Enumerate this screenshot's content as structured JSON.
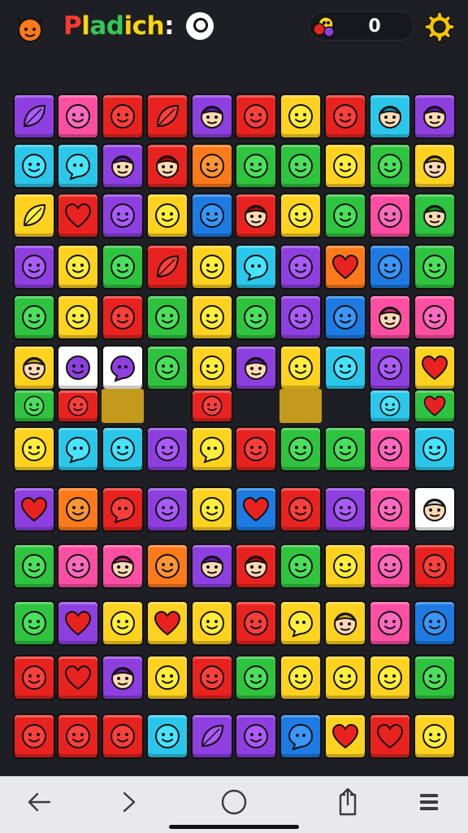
{
  "header": {
    "title_letters": [
      "P",
      "l",
      "a",
      "d",
      "i",
      "c",
      "h",
      ":"
    ],
    "title_colors": [
      "#ff3b30",
      "#ffd60a",
      "#34c759",
      "#34c759",
      "#ffcc00",
      "#ffd60a",
      "#ffd60a",
      "#ffffff"
    ],
    "score": "0",
    "icons": {
      "avatar": "fox-face-icon",
      "badge": "ring-icon",
      "score": "critter-icon",
      "settings": "gear-icon"
    }
  },
  "palette": {
    "V": "#8e3fe0",
    "P": "#ff4fa3",
    "R": "#e8231f",
    "Y": "#ffd21f",
    "G": "#2fc43f",
    "B": "#1d7be3",
    "C": "#2bc7ea",
    "O": "#ff7a1a",
    "W": "#ffffff",
    "K": "#c49a1c"
  },
  "board": {
    "rows": [
      {
        "cells": [
          {
            "c": "V",
            "f": "leaf"
          },
          {
            "c": "P",
            "f": "face"
          },
          {
            "c": "R",
            "f": "face"
          },
          {
            "c": "R",
            "f": "leaf"
          },
          {
            "c": "V",
            "f": "person"
          },
          {
            "c": "R",
            "f": "face"
          },
          {
            "c": "Y",
            "f": "face"
          },
          {
            "c": "R",
            "f": "face"
          },
          {
            "c": "C",
            "f": "person"
          },
          {
            "c": "V",
            "f": "person"
          }
        ]
      },
      {
        "cells": [
          {
            "c": "C",
            "f": "face"
          },
          {
            "c": "C",
            "f": "bubble"
          },
          {
            "c": "V",
            "f": "person"
          },
          {
            "c": "R",
            "f": "person"
          },
          {
            "c": "O",
            "f": "face"
          },
          {
            "c": "G",
            "f": "face"
          },
          {
            "c": "G",
            "f": "face"
          },
          {
            "c": "Y",
            "f": "face"
          },
          {
            "c": "G",
            "f": "face"
          },
          {
            "c": "Y",
            "f": "person"
          }
        ]
      },
      {
        "cells": [
          {
            "c": "Y",
            "f": "leaf"
          },
          {
            "c": "R",
            "f": "heart"
          },
          {
            "c": "V",
            "f": "face"
          },
          {
            "c": "Y",
            "f": "face"
          },
          {
            "c": "B",
            "f": "face"
          },
          {
            "c": "R",
            "f": "person"
          },
          {
            "c": "Y",
            "f": "face"
          },
          {
            "c": "G",
            "f": "face"
          },
          {
            "c": "P",
            "f": "face"
          },
          {
            "c": "G",
            "f": "person"
          }
        ]
      },
      {
        "cells": [
          {
            "c": "V",
            "f": "face"
          },
          {
            "c": "Y",
            "f": "face"
          },
          {
            "c": "G",
            "f": "face"
          },
          {
            "c": "R",
            "f": "leaf"
          },
          {
            "c": "Y",
            "f": "face"
          },
          {
            "c": "C",
            "f": "bubble"
          },
          {
            "c": "V",
            "f": "face"
          },
          {
            "c": "O",
            "f": "heart"
          },
          {
            "c": "B",
            "f": "face"
          },
          {
            "c": "G",
            "f": "face"
          }
        ]
      },
      {
        "cells": [
          {
            "c": "G",
            "f": "face"
          },
          {
            "c": "Y",
            "f": "face"
          },
          {
            "c": "R",
            "f": "face"
          },
          {
            "c": "G",
            "f": "face"
          },
          {
            "c": "Y",
            "f": "face"
          },
          {
            "c": "G",
            "f": "face"
          },
          {
            "c": "V",
            "f": "face"
          },
          {
            "c": "B",
            "f": "face"
          },
          {
            "c": "P",
            "f": "person"
          },
          {
            "c": "P",
            "f": "face"
          }
        ]
      },
      {
        "cells": [
          {
            "c": "Y",
            "f": "person"
          },
          {
            "c": "W",
            "f": "face"
          },
          {
            "c": "W",
            "f": "bubble"
          },
          {
            "c": "G",
            "f": "face"
          },
          {
            "c": "Y",
            "f": "face"
          },
          {
            "c": "V",
            "f": "person"
          },
          {
            "c": "Y",
            "f": "face"
          },
          {
            "c": "C",
            "f": "face"
          },
          {
            "c": "V",
            "f": "face"
          },
          {
            "c": "Y",
            "f": "heart"
          }
        ]
      },
      {
        "cells": [
          {
            "c": "G",
            "f": "face"
          },
          {
            "c": "R",
            "f": "face"
          },
          {
            "c": "K",
            "f": "none"
          },
          {
            "c": "X",
            "f": "none"
          },
          {
            "c": "R",
            "f": "face"
          },
          {
            "c": "X",
            "f": "none"
          },
          {
            "c": "K",
            "f": "none"
          },
          {
            "c": "X",
            "f": "none"
          },
          {
            "c": "C",
            "f": "face"
          },
          {
            "c": "G",
            "f": "heart"
          }
        ]
      },
      {
        "cells": [
          {
            "c": "Y",
            "f": "face"
          },
          {
            "c": "C",
            "f": "bubble"
          },
          {
            "c": "C",
            "f": "face"
          },
          {
            "c": "V",
            "f": "face"
          },
          {
            "c": "Y",
            "f": "bubble"
          },
          {
            "c": "R",
            "f": "face"
          },
          {
            "c": "G",
            "f": "face"
          },
          {
            "c": "G",
            "f": "face"
          },
          {
            "c": "P",
            "f": "face"
          },
          {
            "c": "C",
            "f": "face"
          }
        ]
      },
      {
        "cells": [
          {
            "c": "V",
            "f": "heart"
          },
          {
            "c": "O",
            "f": "face"
          },
          {
            "c": "R",
            "f": "bubble"
          },
          {
            "c": "V",
            "f": "face"
          },
          {
            "c": "Y",
            "f": "face"
          },
          {
            "c": "B",
            "f": "heart"
          },
          {
            "c": "R",
            "f": "face"
          },
          {
            "c": "V",
            "f": "face"
          },
          {
            "c": "P",
            "f": "face"
          },
          {
            "c": "W",
            "f": "person"
          }
        ]
      },
      {
        "cells": [
          {
            "c": "G",
            "f": "face"
          },
          {
            "c": "P",
            "f": "face"
          },
          {
            "c": "P",
            "f": "person"
          },
          {
            "c": "O",
            "f": "face"
          },
          {
            "c": "V",
            "f": "person"
          },
          {
            "c": "R",
            "f": "person"
          },
          {
            "c": "G",
            "f": "face"
          },
          {
            "c": "Y",
            "f": "face"
          },
          {
            "c": "P",
            "f": "face"
          },
          {
            "c": "R",
            "f": "face"
          }
        ]
      },
      {
        "cells": [
          {
            "c": "G",
            "f": "face"
          },
          {
            "c": "V",
            "f": "heart"
          },
          {
            "c": "Y",
            "f": "face"
          },
          {
            "c": "Y",
            "f": "heart"
          },
          {
            "c": "Y",
            "f": "face"
          },
          {
            "c": "R",
            "f": "face"
          },
          {
            "c": "Y",
            "f": "bubble"
          },
          {
            "c": "Y",
            "f": "person"
          },
          {
            "c": "P",
            "f": "face"
          },
          {
            "c": "B",
            "f": "face"
          }
        ]
      },
      {
        "cells": [
          {
            "c": "R",
            "f": "face"
          },
          {
            "c": "R",
            "f": "heart"
          },
          {
            "c": "V",
            "f": "person"
          },
          {
            "c": "Y",
            "f": "face"
          },
          {
            "c": "R",
            "f": "face"
          },
          {
            "c": "G",
            "f": "face"
          },
          {
            "c": "Y",
            "f": "face"
          },
          {
            "c": "Y",
            "f": "face"
          },
          {
            "c": "Y",
            "f": "face"
          },
          {
            "c": "G",
            "f": "face"
          }
        ]
      },
      {
        "cells": [
          {
            "c": "R",
            "f": "face"
          },
          {
            "c": "R",
            "f": "face"
          },
          {
            "c": "R",
            "f": "face"
          },
          {
            "c": "C",
            "f": "face"
          },
          {
            "c": "V",
            "f": "leaf"
          },
          {
            "c": "V",
            "f": "face"
          },
          {
            "c": "B",
            "f": "bubble"
          },
          {
            "c": "Y",
            "f": "heart"
          },
          {
            "c": "R",
            "f": "heart"
          },
          {
            "c": "Y",
            "f": "face"
          }
        ]
      }
    ]
  },
  "nav": {
    "icons": [
      "arrow-left-icon",
      "arrow-right-icon",
      "home-circle-icon",
      "share-icon",
      "menu-icon"
    ]
  }
}
